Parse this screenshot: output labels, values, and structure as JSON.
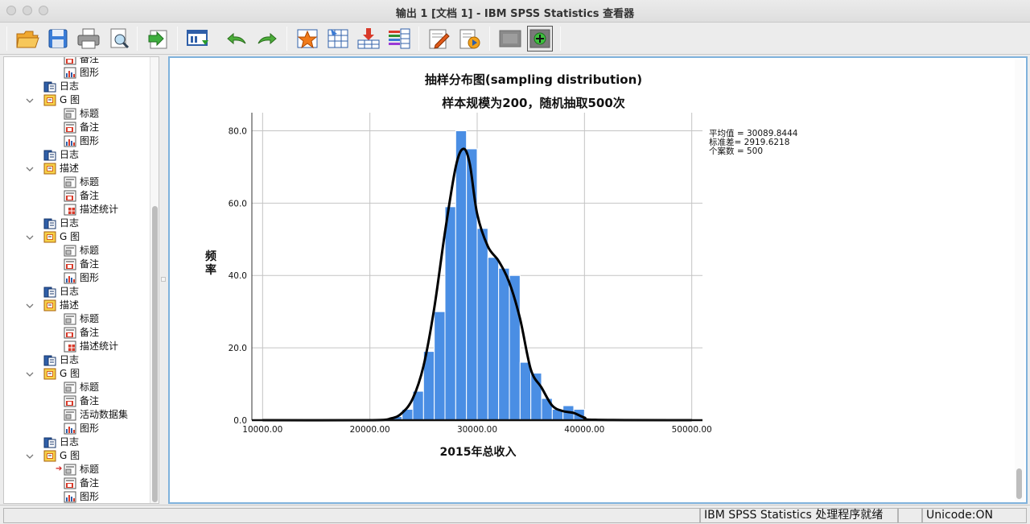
{
  "window": {
    "title": "输出 1 [文档 1] - IBM SPSS Statistics 查看器"
  },
  "toolbar": {
    "buttons": [
      {
        "icon": "open-folder-icon"
      },
      {
        "icon": "save-icon"
      },
      {
        "icon": "print-icon"
      },
      {
        "icon": "print-preview-icon"
      },
      {
        "icon": "export-icon"
      },
      {
        "icon": "recall-dialog-icon"
      },
      {
        "icon": "undo-icon"
      },
      {
        "icon": "redo-icon"
      },
      {
        "icon": "goto-case-icon"
      },
      {
        "icon": "goto-variable-icon"
      },
      {
        "icon": "insert-output-icon"
      },
      {
        "icon": "variables-list-icon"
      },
      {
        "icon": "edit-text-icon"
      },
      {
        "icon": "run-script-icon"
      },
      {
        "icon": "collapse-icon"
      },
      {
        "icon": "add-item-icon"
      }
    ]
  },
  "outline": {
    "items": [
      {
        "level": 2,
        "label": "备注",
        "icon": "note-icon"
      },
      {
        "level": 2,
        "label": "图形",
        "icon": "chart-icon"
      },
      {
        "level": 1,
        "label": "日志",
        "icon": "log-icon"
      },
      {
        "level": 1,
        "label": "G 图",
        "icon": "graph-folder-icon",
        "toggle": true
      },
      {
        "level": 2,
        "label": "标题",
        "icon": "title-icon"
      },
      {
        "level": 2,
        "label": "备注",
        "icon": "note-icon"
      },
      {
        "level": 2,
        "label": "图形",
        "icon": "chart-icon"
      },
      {
        "level": 1,
        "label": "日志",
        "icon": "log-icon"
      },
      {
        "level": 1,
        "label": "描述",
        "icon": "descriptives-folder-icon",
        "toggle": true
      },
      {
        "level": 2,
        "label": "标题",
        "icon": "title-icon"
      },
      {
        "level": 2,
        "label": "备注",
        "icon": "note-icon"
      },
      {
        "level": 2,
        "label": "描述统计",
        "icon": "table-icon"
      },
      {
        "level": 1,
        "label": "日志",
        "icon": "log-icon"
      },
      {
        "level": 1,
        "label": "G 图",
        "icon": "graph-folder-icon",
        "toggle": true
      },
      {
        "level": 2,
        "label": "标题",
        "icon": "title-icon"
      },
      {
        "level": 2,
        "label": "备注",
        "icon": "note-icon"
      },
      {
        "level": 2,
        "label": "图形",
        "icon": "chart-icon"
      },
      {
        "level": 1,
        "label": "日志",
        "icon": "log-icon"
      },
      {
        "level": 1,
        "label": "描述",
        "icon": "descriptives-folder-icon",
        "toggle": true
      },
      {
        "level": 2,
        "label": "标题",
        "icon": "title-icon"
      },
      {
        "level": 2,
        "label": "备注",
        "icon": "note-icon"
      },
      {
        "level": 2,
        "label": "描述统计",
        "icon": "table-icon"
      },
      {
        "level": 1,
        "label": "日志",
        "icon": "log-icon"
      },
      {
        "level": 1,
        "label": "G 图",
        "icon": "graph-folder-icon",
        "toggle": true
      },
      {
        "level": 2,
        "label": "标题",
        "icon": "title-icon"
      },
      {
        "level": 2,
        "label": "备注",
        "icon": "note-icon"
      },
      {
        "level": 2,
        "label": "活动数据集",
        "icon": "title-icon"
      },
      {
        "level": 2,
        "label": "图形",
        "icon": "chart-icon"
      },
      {
        "level": 1,
        "label": "日志",
        "icon": "log-icon"
      },
      {
        "level": 1,
        "label": "G 图",
        "icon": "graph-folder-icon",
        "toggle": true
      },
      {
        "level": 2,
        "label": "标题",
        "icon": "title-icon",
        "current": true
      },
      {
        "level": 2,
        "label": "备注",
        "icon": "note-icon"
      },
      {
        "level": 2,
        "label": "图形",
        "icon": "chart-icon"
      }
    ]
  },
  "chart_data": {
    "type": "bar",
    "title": "抽样分布图(sampling distribution)",
    "subtitle": "样本规模为200，随机抽取500次",
    "xlabel": "2015年总收入",
    "ylabel": "频率",
    "xlim": [
      9000,
      51000
    ],
    "ylim": [
      0,
      85
    ],
    "x_ticks": [
      "10000.00",
      "20000.00",
      "30000.00",
      "40000.00",
      "50000.00"
    ],
    "y_ticks": [
      "0.0",
      "20.0",
      "40.0",
      "60.0",
      "80.0"
    ],
    "grid": true,
    "bin_width": 1000,
    "bins": [
      {
        "start": 22000,
        "end": 23000,
        "value": 1
      },
      {
        "start": 23000,
        "end": 24000,
        "value": 3
      },
      {
        "start": 24000,
        "end": 25000,
        "value": 8
      },
      {
        "start": 25000,
        "end": 26000,
        "value": 19
      },
      {
        "start": 26000,
        "end": 27000,
        "value": 30
      },
      {
        "start": 27000,
        "end": 28000,
        "value": 59
      },
      {
        "start": 28000,
        "end": 29000,
        "value": 80
      },
      {
        "start": 29000,
        "end": 30000,
        "value": 75
      },
      {
        "start": 30000,
        "end": 31000,
        "value": 53
      },
      {
        "start": 31000,
        "end": 32000,
        "value": 45
      },
      {
        "start": 32000,
        "end": 33000,
        "value": 42
      },
      {
        "start": 33000,
        "end": 34000,
        "value": 40
      },
      {
        "start": 34000,
        "end": 35000,
        "value": 16
      },
      {
        "start": 35000,
        "end": 36000,
        "value": 13
      },
      {
        "start": 36000,
        "end": 37000,
        "value": 6
      },
      {
        "start": 37000,
        "end": 38000,
        "value": 3
      },
      {
        "start": 38000,
        "end": 39000,
        "value": 4
      },
      {
        "start": 39000,
        "end": 40000,
        "value": 3
      }
    ],
    "curve": {
      "x": [
        10000,
        20000,
        22000,
        23000,
        24000,
        25000,
        26000,
        27000,
        28000,
        28700,
        29300,
        30000,
        31000,
        32000,
        33000,
        34000,
        35000,
        36000,
        37000,
        38000,
        39000,
        40000,
        41000,
        50000
      ],
      "y": [
        0,
        0,
        0.5,
        2,
        6,
        15,
        31,
        52,
        70,
        75,
        71,
        57,
        48,
        44,
        38,
        28,
        14,
        9,
        4,
        2.5,
        2,
        0.7,
        0.1,
        0
      ]
    },
    "stats": [
      "平均值 = 30089.8444",
      "标准差= 2919.6218",
      "个案数 = 500"
    ],
    "colors": {
      "bar_fill": "#4a8ee4",
      "bar_edge": "#ffffff",
      "curve": "#000000",
      "grid": "#c4c4c4"
    }
  },
  "statusbar": {
    "processor_status": "IBM SPSS Statistics 处理程序就绪",
    "encoding": "Unicode:ON"
  }
}
